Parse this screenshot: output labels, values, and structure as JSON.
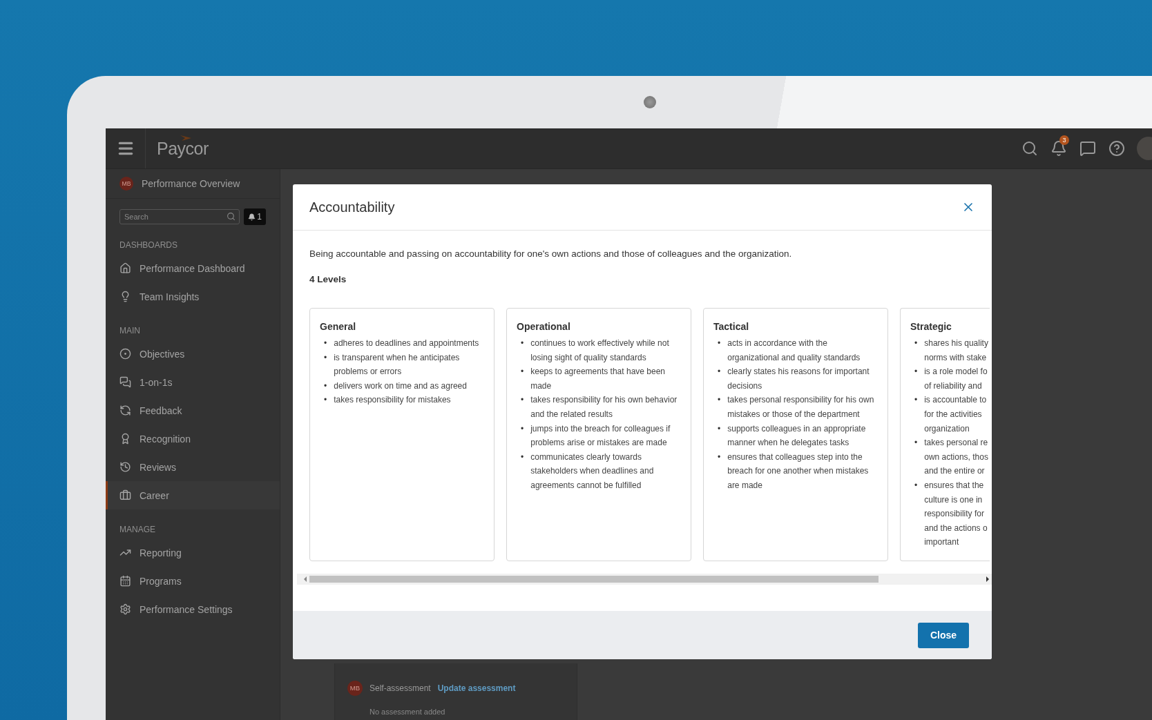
{
  "top_bar": {
    "logo": "Paycor",
    "notification_count": "3"
  },
  "sidebar": {
    "header": {
      "avatar": "MB",
      "title": "Performance Overview"
    },
    "search": {
      "placeholder": "Search"
    },
    "alerts": {
      "count": "1"
    },
    "sections": [
      {
        "title": "DASHBOARDS",
        "items": [
          {
            "label": "Performance Dashboard",
            "selected": false
          },
          {
            "label": "Team Insights",
            "selected": false
          }
        ]
      },
      {
        "title": "MAIN",
        "items": [
          {
            "label": "Objectives",
            "selected": false
          },
          {
            "label": "1-on-1s",
            "selected": false
          },
          {
            "label": "Feedback",
            "selected": false
          },
          {
            "label": "Recognition",
            "selected": false
          },
          {
            "label": "Reviews",
            "selected": false
          },
          {
            "label": "Career",
            "selected": true
          }
        ]
      },
      {
        "title": "MANAGE",
        "items": [
          {
            "label": "Reporting",
            "selected": false
          },
          {
            "label": "Programs",
            "selected": false
          },
          {
            "label": "Performance Settings",
            "selected": false
          }
        ]
      }
    ]
  },
  "background_page": {
    "avatar": "MB",
    "label": "Self-assessment",
    "link": "Update assessment",
    "note": "No assessment added"
  },
  "modal": {
    "title": "Accountability",
    "description": "Being accountable and passing on accountability for one's own actions and those of colleagues and the organization.",
    "levels_count": "4 Levels",
    "bullet_marker": "•",
    "levels": [
      {
        "title": "General",
        "bullets": [
          {
            "lines": [
              "adheres to deadlines and appointments"
            ]
          },
          {
            "lines": [
              "is transparent when he anticipates problems or errors"
            ]
          },
          {
            "lines": [
              "delivers work on time and as agreed"
            ]
          },
          {
            "lines": [
              "takes responsibility for mistakes"
            ]
          }
        ]
      },
      {
        "title": "Operational",
        "bullets": [
          {
            "lines": [
              "continues to work effectively while not losing sight of quality standards"
            ]
          },
          {
            "lines": [
              "keeps to agreements that have been made"
            ]
          },
          {
            "lines": [
              "takes responsibility for his own behavior and the related results"
            ]
          },
          {
            "lines": [
              "jumps into the breach for colleagues if problems arise or mistakes are made"
            ]
          },
          {
            "lines": [
              "communicates clearly towards stakeholders when deadlines and agreements cannot be fulfilled"
            ]
          }
        ]
      },
      {
        "title": "Tactical",
        "bullets": [
          {
            "lines": [
              "acts in accordance with the organizational and quality standards"
            ]
          },
          {
            "lines": [
              "clearly states his reasons for important decisions"
            ]
          },
          {
            "lines": [
              "takes personal responsibility for his own mistakes or those of the department"
            ]
          },
          {
            "lines": [
              "supports colleagues in an appropriate manner when he delegates tasks"
            ]
          },
          {
            "lines": [
              "ensures that colleagues step into the breach for one another when mistakes are made"
            ]
          }
        ]
      },
      {
        "title": "Strategic",
        "bullets": [
          {
            "lines": [
              "shares his quality",
              "norms with stake"
            ]
          },
          {
            "lines": [
              "is a role model fo",
              "of reliability and"
            ]
          },
          {
            "lines": [
              "is accountable to",
              "for the activities",
              "organization"
            ]
          },
          {
            "lines": [
              "takes personal re",
              "own actions, thos",
              "and the entire or"
            ]
          },
          {
            "lines": [
              "ensures that the",
              "culture is one in",
              "responsibility for",
              "and the actions o",
              "important"
            ]
          }
        ]
      }
    ],
    "close_button": "Close"
  }
}
